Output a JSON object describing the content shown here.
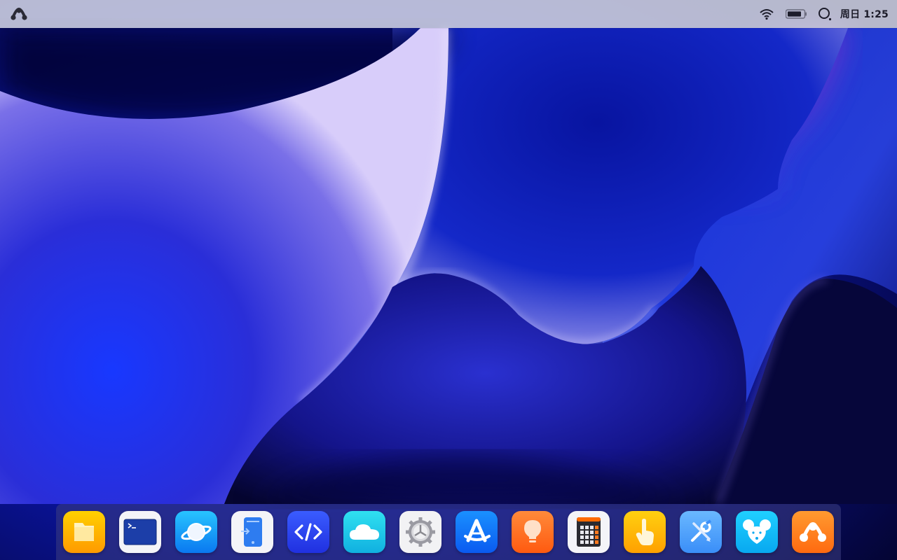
{
  "desktop": {
    "wallpaper_colors": [
      "#050535",
      "#1020c8",
      "#5a40e8",
      "#c8b8f8",
      "#7030c8"
    ]
  },
  "menubar": {
    "logo_icon": "deepin-logo-icon",
    "tray_icons": [
      "wifi-icon",
      "battery-icon",
      "search-icon"
    ],
    "clock": "周日 1:25"
  },
  "dock": {
    "items": [
      {
        "icon": "file-manager-icon",
        "color": "#ffb000"
      },
      {
        "icon": "terminal-icon",
        "color": "#1a3fa0"
      },
      {
        "icon": "browser-planet-icon",
        "color": "#12a0ff"
      },
      {
        "icon": "mobile-transfer-icon",
        "color": "#2e7cf0"
      },
      {
        "icon": "code-editor-icon",
        "color": "#2a3cf0"
      },
      {
        "icon": "cloud-icon",
        "color": "#18c8e8"
      },
      {
        "icon": "system-settings-gear-icon",
        "color": "#9a9aa0"
      },
      {
        "icon": "app-store-icon",
        "color": "#1070ff"
      },
      {
        "icon": "lightbulb-tips-icon",
        "color": "#ff7020"
      },
      {
        "icon": "calculator-icon",
        "color": "#ff6a00"
      },
      {
        "icon": "touch-gesture-icon",
        "color": "#ffb800"
      },
      {
        "icon": "developer-tools-icon",
        "color": "#5aa8ff"
      },
      {
        "icon": "mouse-mascot-icon",
        "color": "#10b8ff"
      },
      {
        "icon": "launcher-icon",
        "color": "#ff7a10"
      }
    ]
  }
}
